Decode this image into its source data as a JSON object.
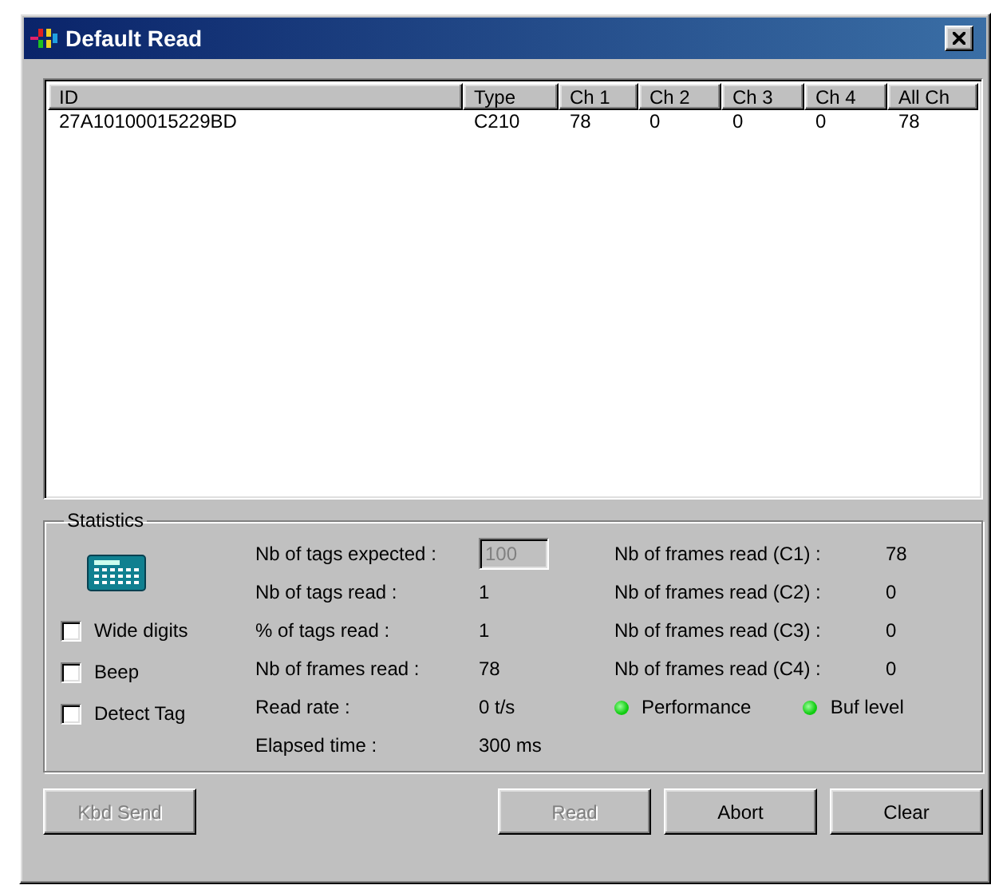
{
  "window": {
    "title": "Default Read"
  },
  "table": {
    "columns": [
      "ID",
      "Type",
      "Ch 1",
      "Ch 2",
      "Ch 3",
      "Ch 4",
      "All Ch"
    ],
    "rows": [
      [
        "27A10100015229BD",
        "C210",
        "78",
        "0",
        "0",
        "0",
        "78"
      ]
    ]
  },
  "statistics": {
    "title": "Statistics",
    "options": [
      {
        "label": "Wide digits",
        "checked": false
      },
      {
        "label": "Beep",
        "checked": false
      },
      {
        "label": "Detect Tag",
        "checked": false
      }
    ],
    "fields": [
      {
        "label": "Nb of tags expected :",
        "value": "100",
        "kind": "input",
        "disabled": true
      },
      {
        "label": "Nb of tags read :",
        "value": "1",
        "kind": "text"
      },
      {
        "label": "% of tags read :",
        "value": "1",
        "kind": "text"
      },
      {
        "label": "Nb of frames read :",
        "value": "78",
        "kind": "text"
      },
      {
        "label": "Read rate :",
        "value": "0 t/s",
        "kind": "text"
      },
      {
        "label": "Elapsed time :",
        "value": "300 ms",
        "kind": "text"
      }
    ],
    "channel_frames": [
      {
        "label": "Nb of frames read (C1) :",
        "value": "78"
      },
      {
        "label": "Nb of frames read (C2) :",
        "value": "0"
      },
      {
        "label": "Nb of frames read (C3) :",
        "value": "0"
      },
      {
        "label": "Nb of frames read (C4) :",
        "value": "0"
      }
    ],
    "indicators": [
      {
        "label": "Performance",
        "on": true
      },
      {
        "label": "Buf level",
        "on": true
      }
    ]
  },
  "buttons": [
    {
      "label": "Kbd Send",
      "disabled": true
    },
    {
      "label": "Read",
      "disabled": true
    },
    {
      "label": "Abort",
      "disabled": false
    },
    {
      "label": "Clear",
      "disabled": false
    }
  ]
}
